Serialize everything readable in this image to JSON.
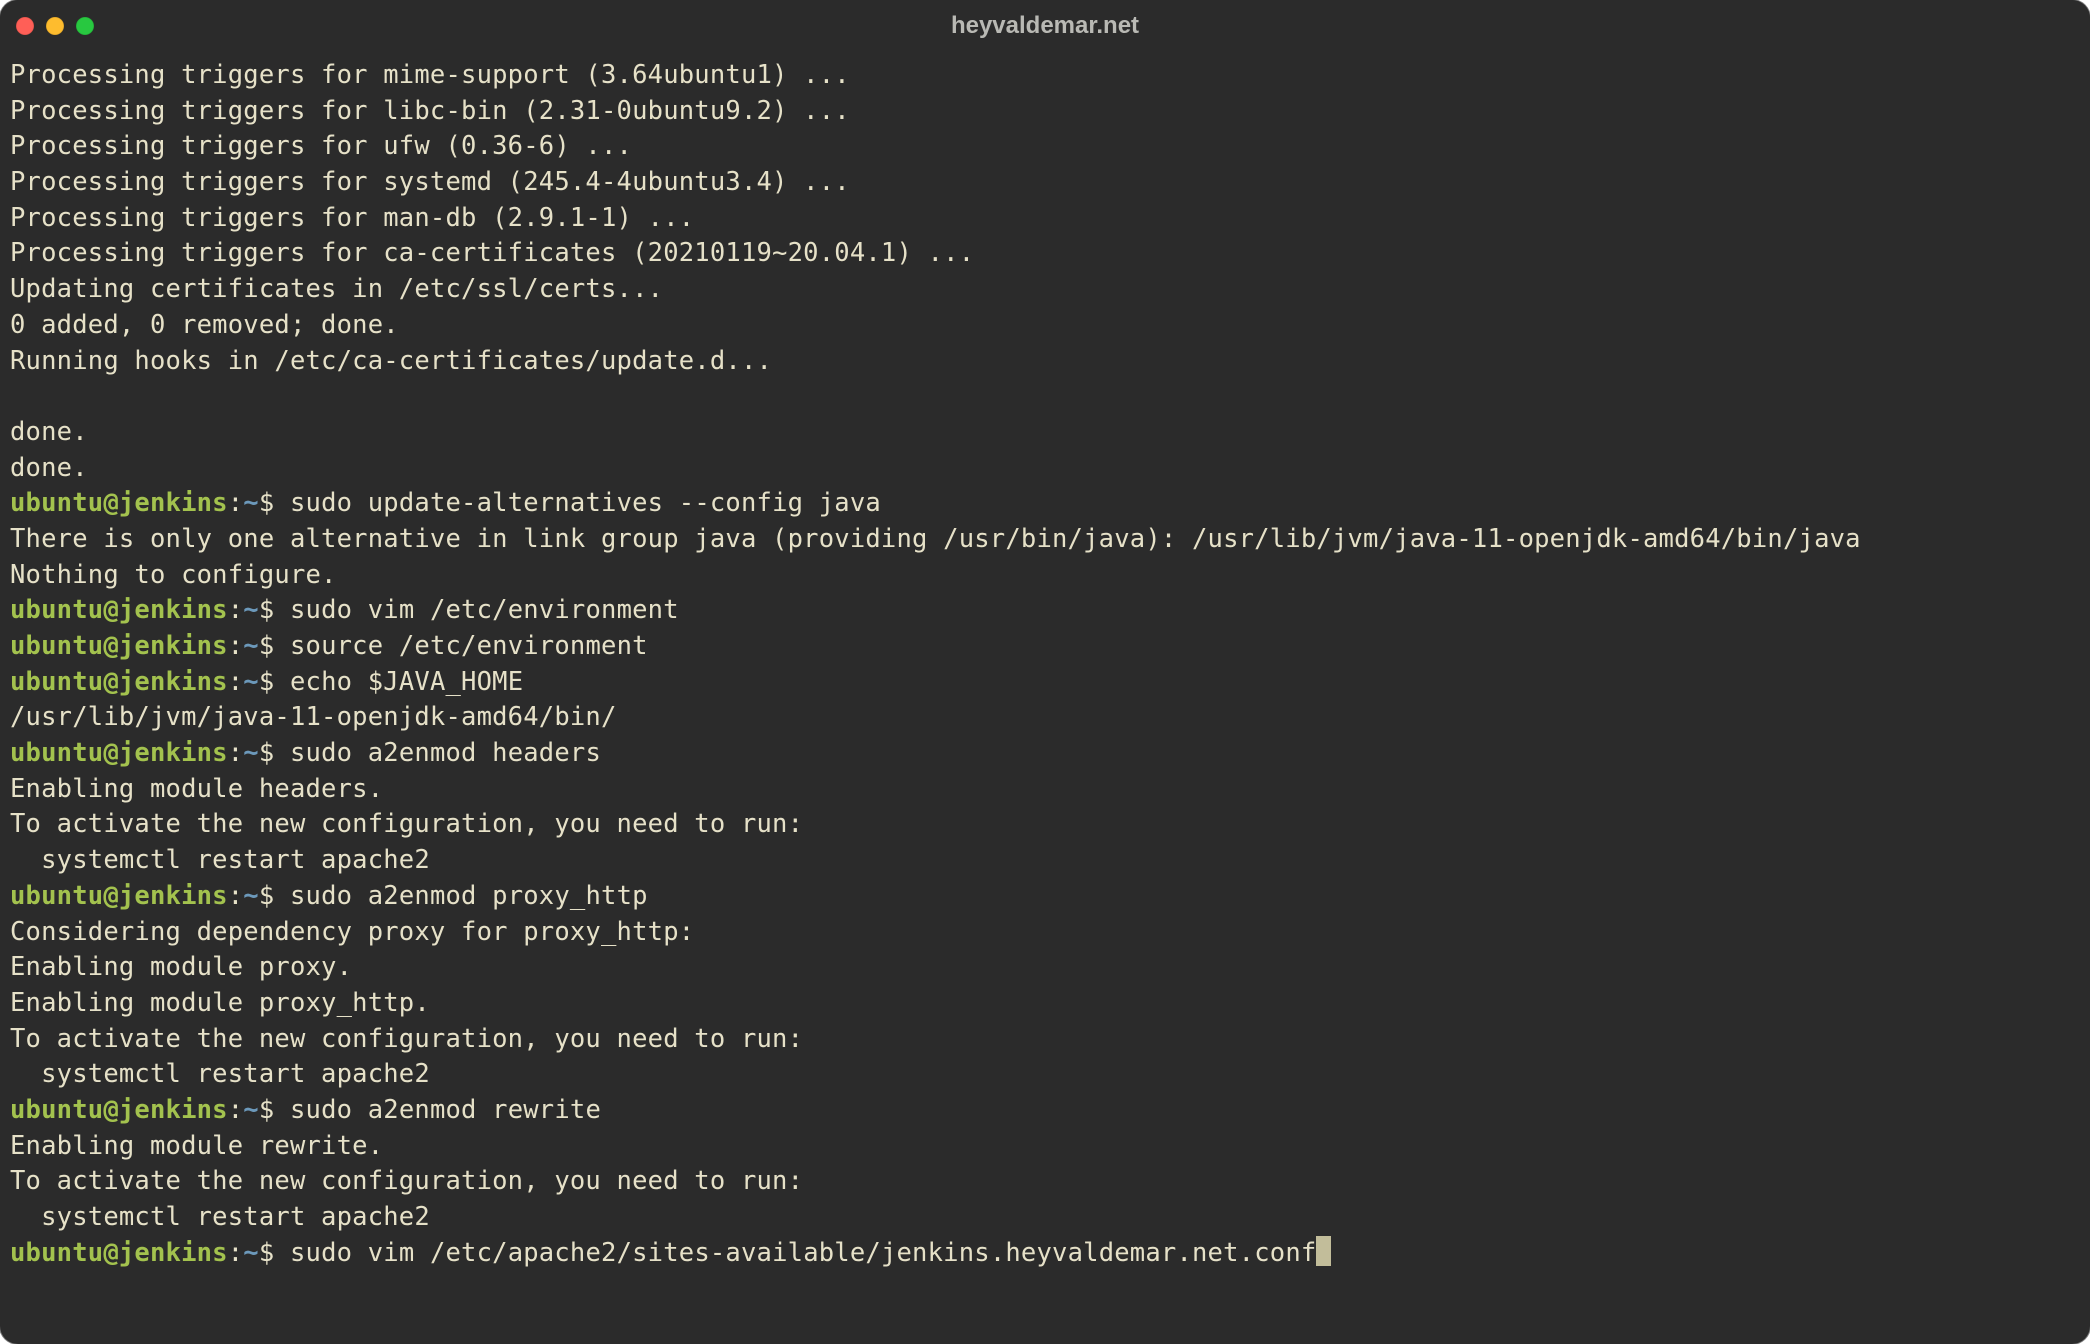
{
  "window": {
    "title": "heyvaldemar.net"
  },
  "colors": {
    "bg": "#2b2b2b",
    "text": "#e6e1c8",
    "prompt_user": "#a3c24e",
    "prompt_path": "#6c99bb",
    "traffic_red": "#ff5f57",
    "traffic_yellow": "#febc2e",
    "traffic_green": "#28c840"
  },
  "prompt": {
    "user": "ubuntu@jenkins",
    "colon": ":",
    "path": "~",
    "symbol": "$"
  },
  "lines": [
    {
      "type": "out",
      "text": "Processing triggers for mime-support (3.64ubuntu1) ..."
    },
    {
      "type": "out",
      "text": "Processing triggers for libc-bin (2.31-0ubuntu9.2) ..."
    },
    {
      "type": "out",
      "text": "Processing triggers for ufw (0.36-6) ..."
    },
    {
      "type": "out",
      "text": "Processing triggers for systemd (245.4-4ubuntu3.4) ..."
    },
    {
      "type": "out",
      "text": "Processing triggers for man-db (2.9.1-1) ..."
    },
    {
      "type": "out",
      "text": "Processing triggers for ca-certificates (20210119~20.04.1) ..."
    },
    {
      "type": "out",
      "text": "Updating certificates in /etc/ssl/certs..."
    },
    {
      "type": "out",
      "text": "0 added, 0 removed; done."
    },
    {
      "type": "out",
      "text": "Running hooks in /etc/ca-certificates/update.d..."
    },
    {
      "type": "out",
      "text": ""
    },
    {
      "type": "out",
      "text": "done."
    },
    {
      "type": "out",
      "text": "done."
    },
    {
      "type": "cmd",
      "text": "sudo update-alternatives --config java"
    },
    {
      "type": "out",
      "text": "There is only one alternative in link group java (providing /usr/bin/java): /usr/lib/jvm/java-11-openjdk-amd64/bin/java"
    },
    {
      "type": "out",
      "text": "Nothing to configure."
    },
    {
      "type": "cmd",
      "text": "sudo vim /etc/environment"
    },
    {
      "type": "cmd",
      "text": "source /etc/environment"
    },
    {
      "type": "cmd",
      "text": "echo $JAVA_HOME"
    },
    {
      "type": "out",
      "text": "/usr/lib/jvm/java-11-openjdk-amd64/bin/"
    },
    {
      "type": "cmd",
      "text": "sudo a2enmod headers"
    },
    {
      "type": "out",
      "text": "Enabling module headers."
    },
    {
      "type": "out",
      "text": "To activate the new configuration, you need to run:"
    },
    {
      "type": "out",
      "text": "  systemctl restart apache2"
    },
    {
      "type": "cmd",
      "text": "sudo a2enmod proxy_http"
    },
    {
      "type": "out",
      "text": "Considering dependency proxy for proxy_http:"
    },
    {
      "type": "out",
      "text": "Enabling module proxy."
    },
    {
      "type": "out",
      "text": "Enabling module proxy_http."
    },
    {
      "type": "out",
      "text": "To activate the new configuration, you need to run:"
    },
    {
      "type": "out",
      "text": "  systemctl restart apache2"
    },
    {
      "type": "cmd",
      "text": "sudo a2enmod rewrite"
    },
    {
      "type": "out",
      "text": "Enabling module rewrite."
    },
    {
      "type": "out",
      "text": "To activate the new configuration, you need to run:"
    },
    {
      "type": "out",
      "text": "  systemctl restart apache2"
    },
    {
      "type": "cmd",
      "text": "sudo vim /etc/apache2/sites-available/jenkins.heyvaldemar.net.conf",
      "cursor": true
    }
  ]
}
